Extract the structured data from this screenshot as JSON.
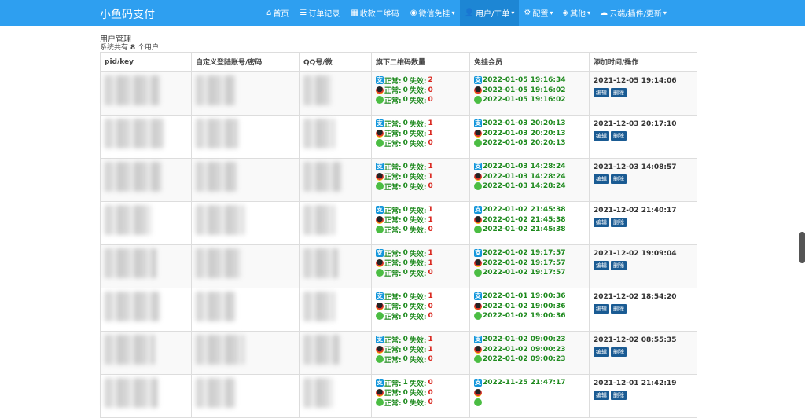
{
  "brand": "小鱼码支付",
  "nav": [
    {
      "icon": "⌂",
      "label": "首页",
      "name": "nav-home",
      "caret": ""
    },
    {
      "icon": "☰",
      "label": "订单记录",
      "name": "nav-orders",
      "caret": ""
    },
    {
      "icon": "▦",
      "label": "收款二维码",
      "name": "nav-qrcode",
      "caret": ""
    },
    {
      "icon": "◉",
      "label": "微信免挂",
      "name": "nav-wechat",
      "caret": "▾"
    },
    {
      "icon": "👤",
      "label": "用户/工单",
      "name": "nav-users",
      "caret": "▾",
      "active": true
    },
    {
      "icon": "⚙",
      "label": "配置",
      "name": "nav-config",
      "caret": "▾"
    },
    {
      "icon": "◈",
      "label": "其他",
      "name": "nav-other",
      "caret": "▾"
    },
    {
      "icon": "☁",
      "label": "云端/插件/更新",
      "name": "nav-cloud",
      "caret": "▾"
    }
  ],
  "page": {
    "title": "用户管理",
    "count_prefix": "系统共有",
    "count": "8",
    "count_suffix": "个用户"
  },
  "table": {
    "headers": [
      "pid/key",
      "自定义登陆账号/密码",
      "QQ号/微",
      "旗下二维码数量",
      "免挂会员",
      "添加时间/操作"
    ],
    "ok_label": "正常:",
    "fail_label": "失效:",
    "edit_label": "编辑",
    "delete_label": "删除",
    "rows": [
      {
        "qr": [
          [
            "0",
            "2"
          ],
          [
            "0",
            "0"
          ],
          [
            "0",
            "0"
          ]
        ],
        "vip": [
          "2022-01-05 19:16:34",
          "2022-01-05 19:16:02",
          "2022-01-05 19:16:02"
        ],
        "added": "2021-12-05 19:14:06"
      },
      {
        "qr": [
          [
            "0",
            "1"
          ],
          [
            "0",
            "1"
          ],
          [
            "0",
            "0"
          ]
        ],
        "vip": [
          "2022-01-03 20:20:13",
          "2022-01-03 20:20:13",
          "2022-01-03 20:20:13"
        ],
        "added": "2021-12-03 20:17:10"
      },
      {
        "qr": [
          [
            "0",
            "1"
          ],
          [
            "0",
            "1"
          ],
          [
            "0",
            "0"
          ]
        ],
        "vip": [
          "2022-01-03 14:28:24",
          "2022-01-03 14:28:24",
          "2022-01-03 14:28:24"
        ],
        "added": "2021-12-03 14:08:57"
      },
      {
        "qr": [
          [
            "0",
            "1"
          ],
          [
            "0",
            "1"
          ],
          [
            "0",
            "0"
          ]
        ],
        "vip": [
          "2022-01-02 21:45:38",
          "2022-01-02 21:45:38",
          "2022-01-02 21:45:38"
        ],
        "added": "2021-12-02 21:40:17"
      },
      {
        "qr": [
          [
            "0",
            "1"
          ],
          [
            "0",
            "1"
          ],
          [
            "0",
            "0"
          ]
        ],
        "vip": [
          "2022-01-02 19:17:57",
          "2022-01-02 19:17:57",
          "2022-01-02 19:17:57"
        ],
        "added": "2021-12-02 19:09:04"
      },
      {
        "qr": [
          [
            "0",
            "1"
          ],
          [
            "0",
            "0"
          ],
          [
            "0",
            "0"
          ]
        ],
        "vip": [
          "2022-01-01 19:00:36",
          "2022-01-02 19:00:36",
          "2022-01-02 19:00:36"
        ],
        "added": "2021-12-02 18:54:20"
      },
      {
        "qr": [
          [
            "0",
            "1"
          ],
          [
            "0",
            "1"
          ],
          [
            "0",
            "0"
          ]
        ],
        "vip": [
          "2022-01-02 09:00:23",
          "2022-01-02 09:00:23",
          "2022-01-02 09:00:23"
        ],
        "added": "2021-12-02 08:55:35"
      },
      {
        "qr": [
          [
            "1",
            "0"
          ],
          [
            "0",
            "0"
          ],
          [
            "0",
            "0"
          ]
        ],
        "vip": [
          "2022-11-25 21:47:17",
          "",
          ""
        ],
        "added": "2021-12-01 21:42:19"
      }
    ]
  },
  "colors": {
    "navbar": "#2e9ff0",
    "ok": "#1e8a1e",
    "fail": "#d9251c",
    "button": "#1a5b93"
  }
}
